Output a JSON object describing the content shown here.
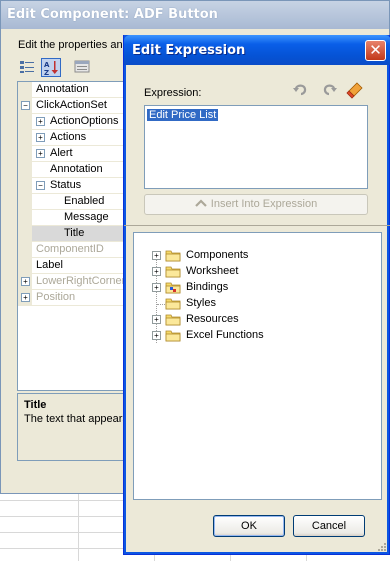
{
  "background_dialog": {
    "title": "Edit Component: ADF Button",
    "description": "Edit the properties and",
    "toolbar": {
      "icons": [
        "categorized-view-icon",
        "alphabetical-sort-icon",
        "property-pages-icon"
      ]
    },
    "properties": [
      {
        "label": "Annotation",
        "level": 0,
        "expander": "",
        "dim": false
      },
      {
        "label": "ClickActionSet",
        "level": 0,
        "expander": "minus",
        "dim": false
      },
      {
        "label": "ActionOptions",
        "level": 1,
        "expander": "plus",
        "dim": false
      },
      {
        "label": "Actions",
        "level": 1,
        "expander": "plus",
        "dim": false
      },
      {
        "label": "Alert",
        "level": 1,
        "expander": "plus",
        "dim": false
      },
      {
        "label": "Annotation",
        "level": 1,
        "expander": "",
        "dim": false
      },
      {
        "label": "Status",
        "level": 1,
        "expander": "minus",
        "dim": false
      },
      {
        "label": "Enabled",
        "level": 2,
        "expander": "",
        "dim": false
      },
      {
        "label": "Message",
        "level": 2,
        "expander": "",
        "dim": false
      },
      {
        "label": "Title",
        "level": 2,
        "expander": "",
        "dim": false,
        "selected": true
      },
      {
        "label": "ComponentID",
        "level": 0,
        "expander": "",
        "dim": true
      },
      {
        "label": "Label",
        "level": 0,
        "expander": "",
        "dim": false
      },
      {
        "label": "LowerRightCorner",
        "level": 0,
        "expander": "plus",
        "dim": true
      },
      {
        "label": "Position",
        "level": 0,
        "expander": "plus",
        "dim": true
      }
    ],
    "help": {
      "title": "Title",
      "text": "The text that appears"
    }
  },
  "expression_dialog": {
    "title": "Edit Expression",
    "close_glyph": "✕",
    "expression_label": "Expression:",
    "expression_value": "Edit Price List",
    "header_icons": [
      "undo-icon",
      "redo-icon",
      "clear-eraser-icon"
    ],
    "insert_button": "Insert Into Expression",
    "tree": [
      {
        "label": "Components",
        "expandable": true,
        "icon": "folder-icon"
      },
      {
        "label": "Worksheet",
        "expandable": true,
        "icon": "folder-icon"
      },
      {
        "label": "Bindings",
        "expandable": true,
        "icon": "bindings-folder-icon"
      },
      {
        "label": "Styles",
        "expandable": false,
        "icon": "folder-icon"
      },
      {
        "label": "Resources",
        "expandable": true,
        "icon": "folder-icon"
      },
      {
        "label": "Excel Functions",
        "expandable": true,
        "icon": "folder-icon"
      }
    ],
    "ok_button": "OK",
    "cancel_button": "Cancel"
  },
  "colors": {
    "titlebar_blue": "#0553d5",
    "selection_blue": "#316ac5",
    "dialog_face": "#ece9d8",
    "folder_yellow": "#f5d96b"
  }
}
